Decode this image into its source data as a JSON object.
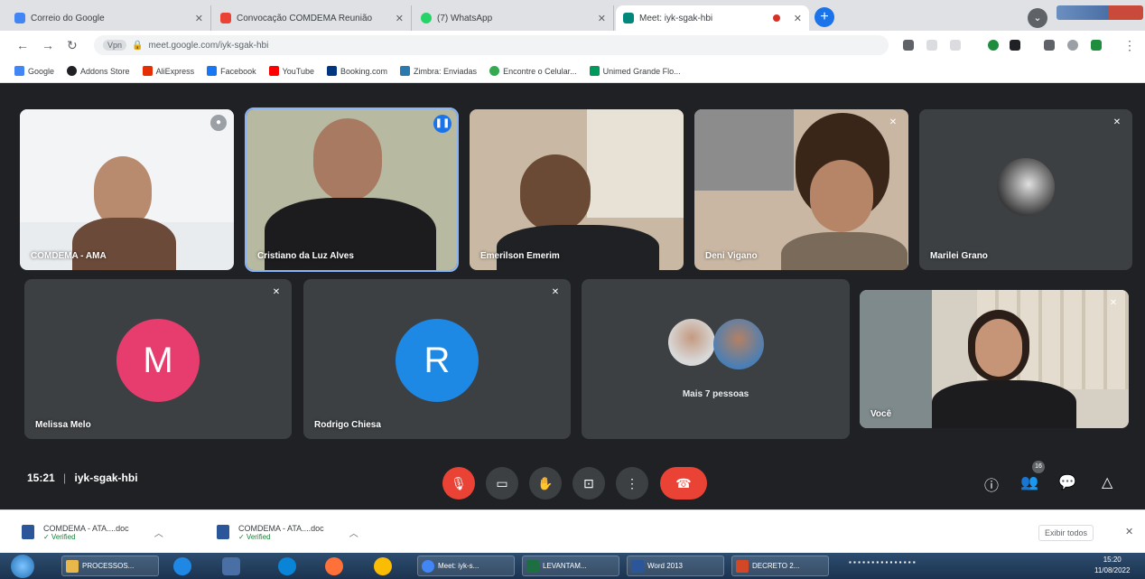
{
  "browser": {
    "tabs": [
      {
        "title": "Correio do Google",
        "favicon": "#4285f4"
      },
      {
        "title": "Convocação COMDEMA Reunião",
        "favicon": "#ea4335"
      },
      {
        "title": "(7) WhatsApp",
        "favicon": "#25d366"
      },
      {
        "title": "Meet: iyk-sgak-hbi",
        "favicon": "#00897b"
      }
    ],
    "url": "meet.google.com/iyk-sgak-hbi",
    "url_chip": "Vpn",
    "bookmarks": [
      {
        "label": "Google",
        "color": "#4285f4"
      },
      {
        "label": "Addons Store",
        "color": "#202124"
      },
      {
        "label": "AliExpress",
        "color": "#e62e04"
      },
      {
        "label": "Facebook",
        "color": "#1877f2"
      },
      {
        "label": "YouTube",
        "color": "#ff0000"
      },
      {
        "label": "Booking.com",
        "color": "#003580"
      },
      {
        "label": "Zimbra: Enviadas",
        "color": "#2a7ab0"
      },
      {
        "label": "Encontre o Celular...",
        "color": "#34a853"
      },
      {
        "label": "Unimed Grande Flo...",
        "color": "#00995d"
      }
    ]
  },
  "meet": {
    "participants": [
      {
        "name": "COMDEMA - AMA",
        "avatar_letter": "",
        "avatar_color": ""
      },
      {
        "name": "Cristiano da Luz Alves",
        "avatar_letter": "",
        "avatar_color": ""
      },
      {
        "name": "Emerilson Emerim",
        "avatar_letter": "",
        "avatar_color": ""
      },
      {
        "name": "Deni Vigano",
        "avatar_letter": "",
        "avatar_color": ""
      },
      {
        "name": "Marilei Grano",
        "avatar_letter": "",
        "avatar_color": ""
      },
      {
        "name": "Melissa Melo",
        "avatar_letter": "M",
        "avatar_color": "#e63d6e"
      },
      {
        "name": "Rodrigo Chiesa",
        "avatar_letter": "R",
        "avatar_color": "#1e88e5"
      },
      {
        "name": "Mais 7 pessoas",
        "avatar_letter": "",
        "avatar_color": ""
      },
      {
        "name": "Você",
        "avatar_letter": "",
        "avatar_color": ""
      }
    ],
    "time": "15:21",
    "separator": "|",
    "meeting_code": "iyk-sgak-hbi",
    "people_count": "16"
  },
  "downloads": {
    "items": [
      {
        "name": "COMDEMA - ATA....doc",
        "status": "✓ Verified"
      },
      {
        "name": "COMDEMA - ATA....doc",
        "status": "✓ Verified"
      }
    ],
    "show_all": "Exibir todos"
  },
  "taskbar": {
    "items": [
      {
        "label": "PROCESSOS...",
        "color": "#e8b84a"
      },
      {
        "label": "Meet: iyk-s...",
        "color": "#4285f4"
      },
      {
        "label": "LEVANTAM...",
        "color": "#1d6f42"
      },
      {
        "label": "Word 2013",
        "color": "#2b579a"
      },
      {
        "label": "DECRETO 2...",
        "color": "#d24726"
      }
    ],
    "clock_time": "15:20",
    "clock_date": "11/08/2022"
  },
  "colors": {
    "meet_bg": "#202124",
    "tile_bg": "#3c4043",
    "red": "#ea4335",
    "blue": "#1a73e8"
  }
}
